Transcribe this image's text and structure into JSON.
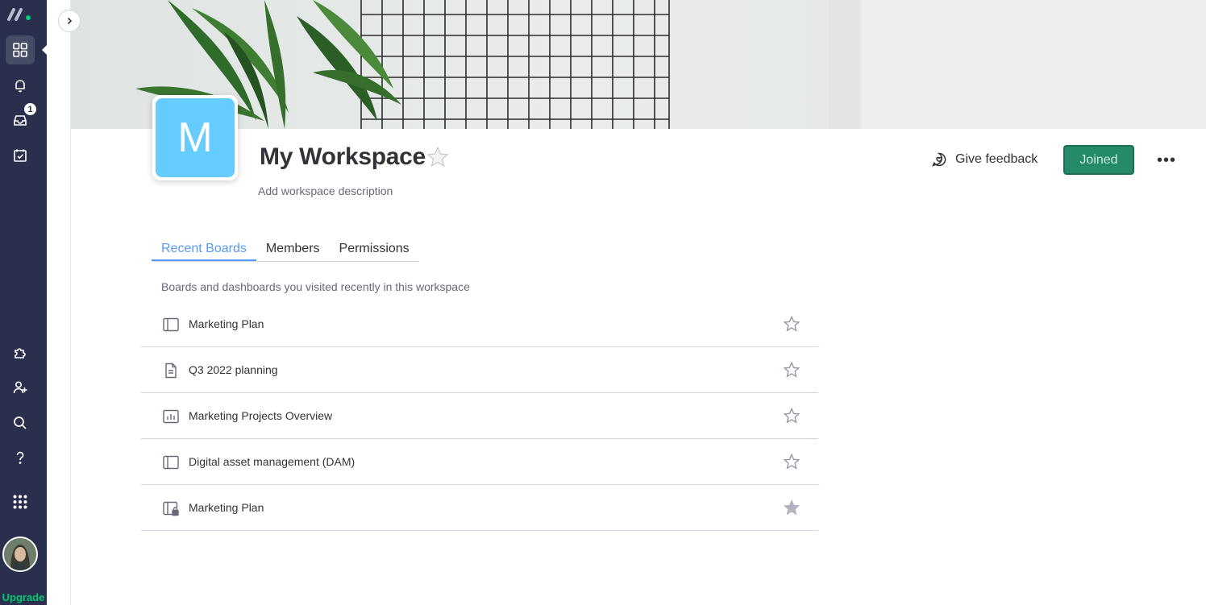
{
  "rail": {
    "items": [
      {
        "name": "workspaces-icon",
        "active": true
      },
      {
        "name": "notifications-bell-icon"
      },
      {
        "name": "inbox-icon",
        "badge": "1"
      },
      {
        "name": "my-work-icon"
      },
      {
        "name": "apps-marketplace-icon"
      },
      {
        "name": "invite-members-icon"
      },
      {
        "name": "search-icon"
      },
      {
        "name": "help-icon"
      },
      {
        "name": "product-switcher-icon"
      }
    ],
    "upgrade_label": "Upgrade"
  },
  "workspace": {
    "initial": "M",
    "title": "My Workspace",
    "description": "Add workspace description",
    "feedback_label": "Give feedback",
    "joined_label": "Joined",
    "more_label": "•••"
  },
  "tabs": [
    {
      "label": "Recent Boards",
      "active": true
    },
    {
      "label": "Members"
    },
    {
      "label": "Permissions"
    }
  ],
  "list_hint": "Boards and dashboards you visited recently in this workspace",
  "boards": [
    {
      "name": "Marketing Plan",
      "icon": "board-icon",
      "favorite": false
    },
    {
      "name": "Q3 2022 planning",
      "icon": "document-icon",
      "favorite": false
    },
    {
      "name": "Marketing Projects Overview",
      "icon": "dashboard-icon",
      "favorite": false
    },
    {
      "name": "Digital asset management (DAM)",
      "icon": "board-icon",
      "favorite": false
    },
    {
      "name": "Marketing Plan",
      "icon": "private-board-icon",
      "favorite": true
    }
  ],
  "colors": {
    "rail_bg": "#292f4c",
    "accent_blue": "#579bfc",
    "workspace_avatar": "#66ccff",
    "joined_bg": "#258a6a",
    "upgrade_green": "#00ca72"
  }
}
